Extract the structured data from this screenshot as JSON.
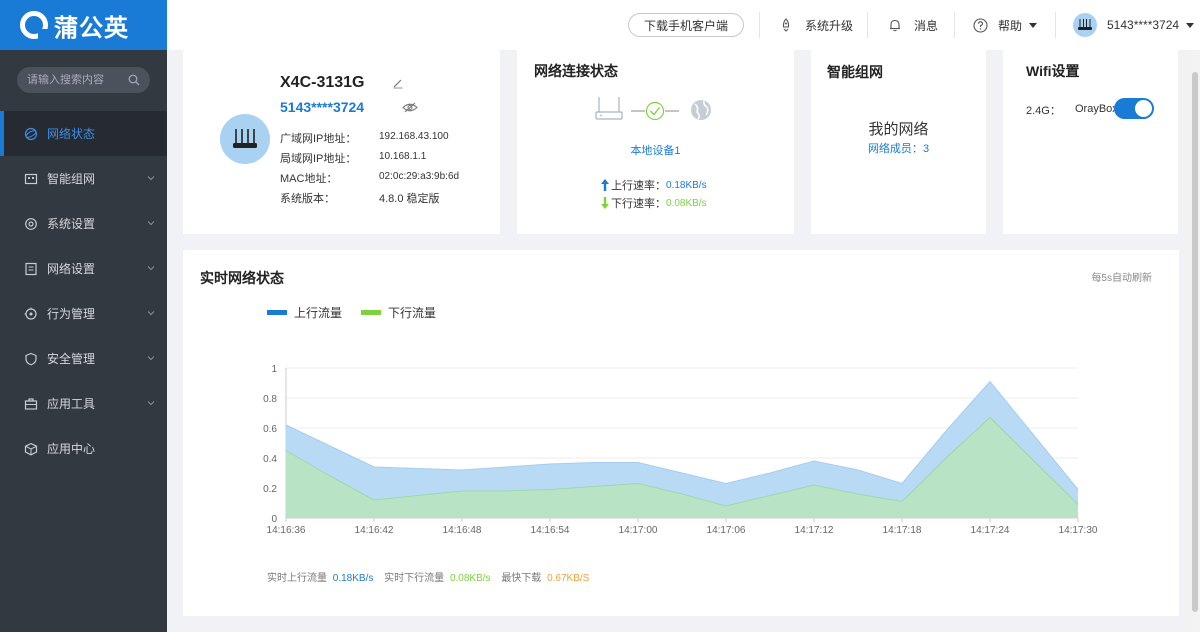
{
  "app": {
    "logo_text": "蒲公英"
  },
  "sidebar": {
    "search_placeholder": "请输入搜索内容",
    "items": [
      {
        "label": "网络状态",
        "active": true,
        "has_children": false
      },
      {
        "label": "智能组网",
        "active": false,
        "has_children": true
      },
      {
        "label": "系统设置",
        "active": false,
        "has_children": true
      },
      {
        "label": "网络设置",
        "active": false,
        "has_children": true
      },
      {
        "label": "行为管理",
        "active": false,
        "has_children": true
      },
      {
        "label": "安全管理",
        "active": false,
        "has_children": true
      },
      {
        "label": "应用工具",
        "active": false,
        "has_children": true
      },
      {
        "label": "应用中心",
        "active": false,
        "has_children": false
      }
    ]
  },
  "header": {
    "download_btn": "下载手机客户端",
    "upgrade": "系统升级",
    "messages": "消息",
    "help": "帮助",
    "user": "5143****3724"
  },
  "device": {
    "model": "X4C-3131G",
    "account": "5143****3724",
    "wan_label": "广域网IP地址：",
    "wan_value": "192.168.43.100",
    "lan_label": "局域网IP地址：",
    "lan_value": "10.168.1.1",
    "mac_label": "MAC地址：",
    "mac_value": "02:0c:29:a3:9b:6d",
    "ver_label": "系统版本：",
    "ver_value": "4.8.0 稳定版"
  },
  "connection": {
    "title": "网络连接状态",
    "device_link": "本地设备1",
    "up_label": "上行速率：",
    "up_value": "0.18KB/s",
    "down_label": "下行速率：",
    "down_value": "0.08KB/s"
  },
  "smartnet": {
    "title": "智能组网",
    "network_name": "我的网络",
    "members_label": "网络成员：",
    "members_count": "3"
  },
  "wifi": {
    "title": "Wifi设置",
    "band": "2.4G：",
    "ssid": "OrayBox",
    "enabled": true
  },
  "realtime": {
    "title": "实时网络状态",
    "refresh_note": "每5s自动刷新",
    "stats": {
      "up_label": "实时上行流量",
      "up_value": "0.18KB/s",
      "down_label": "实时下行流量",
      "down_value": "0.08KB/s",
      "peak_label": "最快下载",
      "peak_value": "0.67KB/S"
    }
  },
  "colors": {
    "brand": "#1a7bd6",
    "upload": "#1a7bd6",
    "download": "#7ed23e",
    "sidebar_bg": "#333941",
    "peak": "#f0a23c"
  },
  "chart_data": {
    "type": "area",
    "title": "",
    "xlabel": "",
    "ylabel": "",
    "categories": [
      "14:16:36",
      "14:16:39",
      "14:16:42",
      "14:16:45",
      "14:16:48",
      "14:16:51",
      "14:16:54",
      "14:16:57",
      "14:17:00",
      "14:17:03",
      "14:17:06",
      "14:17:09",
      "14:17:12",
      "14:17:15",
      "14:17:18",
      "14:17:21",
      "14:17:24",
      "14:17:27",
      "14:17:30"
    ],
    "tick_labels": [
      "14:16:36",
      "14:16:42",
      "14:16:48",
      "14:16:54",
      "14:17:00",
      "14:17:06",
      "14:17:12",
      "14:17:18",
      "14:17:24",
      "14:17:30"
    ],
    "ylim": [
      0,
      1
    ],
    "yticks": [
      0,
      0.2,
      0.4,
      0.6,
      0.8,
      1
    ],
    "grid": true,
    "legend_position": "top-left",
    "series": [
      {
        "name": "上行流量",
        "color": "#1a7bd6",
        "values": [
          0.62,
          0.48,
          0.34,
          0.33,
          0.32,
          0.34,
          0.36,
          0.37,
          0.37,
          0.3,
          0.23,
          0.3,
          0.38,
          0.32,
          0.23,
          0.58,
          0.91,
          0.55,
          0.19
        ]
      },
      {
        "name": "下行流量",
        "color": "#7ed23e",
        "values": [
          0.45,
          0.28,
          0.12,
          0.15,
          0.18,
          0.18,
          0.19,
          0.21,
          0.23,
          0.16,
          0.08,
          0.15,
          0.22,
          0.16,
          0.11,
          0.4,
          0.67,
          0.38,
          0.09
        ]
      }
    ]
  }
}
